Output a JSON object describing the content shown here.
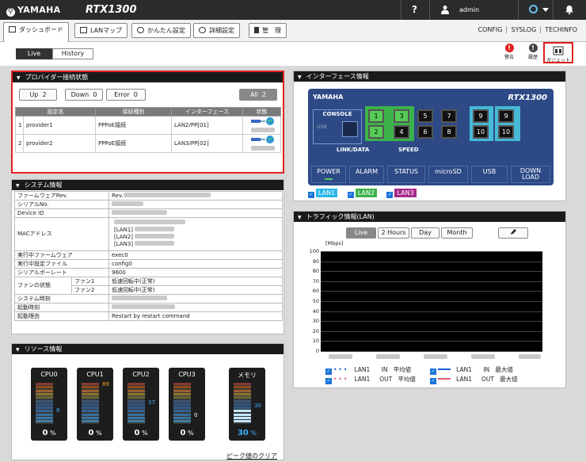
{
  "topbar": {
    "brand": "YAMAHA",
    "model": "RTX1300",
    "help": "?",
    "user": "admin"
  },
  "tabs": [
    {
      "label": "ダッシュボード"
    },
    {
      "label": "LANマップ"
    },
    {
      "label": "かんたん設定"
    },
    {
      "label": "詳細設定"
    },
    {
      "label": "管　理"
    }
  ],
  "right_links": [
    "CONFIG",
    "SYSLOG",
    "TECHINFO"
  ],
  "subtabs": {
    "live": "Live",
    "history": "History"
  },
  "topicons": {
    "warning": "警告",
    "history": "履歴",
    "gadget": "ガジェット"
  },
  "provider": {
    "title": "プロバイダー接続状態",
    "btn_up": "Up",
    "up_count": "2",
    "btn_down": "Down",
    "down_count": "0",
    "btn_error": "Error",
    "error_count": "0",
    "btn_all": "All",
    "all_count": "2",
    "headers": [
      "設定名",
      "接続種別",
      "インターフェース",
      "状態"
    ],
    "rows": [
      {
        "no": "1",
        "name": "provider1",
        "type": "PPPoE接続",
        "iface": "LAN2/PP[01]"
      },
      {
        "no": "2",
        "name": "provider2",
        "type": "PPPoE接続",
        "iface": "LAN3/PP[02]"
      }
    ]
  },
  "system": {
    "title": "システム情報",
    "fw_rev_label": "ファームウェアRev.",
    "fw_rev_value": "Rev.",
    "serial_label": "シリアルNo.",
    "devid_label": "Device ID",
    "mac_label": "MACアドレス",
    "mac1": "[LAN1]",
    "mac2": "[LAN2]",
    "mac3": "[LAN3]",
    "exec_fw_label": "実行中ファームウェア",
    "exec_fw_value": "exec0",
    "exec_cfg_label": "実行中設定ファイル",
    "exec_cfg_value": "config0",
    "baud_label": "シリアルボーレート",
    "baud_value": "9600",
    "fan_label": "ファンの状態",
    "fan1_label": "ファン1",
    "fan1_value": "低速回転中(正常)",
    "fan2_label": "ファン2",
    "fan2_value": "低速回転中(正常)",
    "time_label": "システム時刻",
    "boot_time_label": "起動時刻",
    "boot_reason_label": "起動理由",
    "boot_reason_value": "Restart by restart command"
  },
  "resource": {
    "title": "リソース情報",
    "meters": [
      {
        "name": "CPU0",
        "percent": "0",
        "peak": "8",
        "unit": "%"
      },
      {
        "name": "CPU1",
        "percent": "0",
        "peak": "89",
        "unit": "%"
      },
      {
        "name": "CPU2",
        "percent": "0",
        "peak": "37",
        "unit": "%"
      },
      {
        "name": "CPU3",
        "percent": "0",
        "peak": "0",
        "unit": "%"
      },
      {
        "name": "メモリ",
        "percent": "30",
        "peak": "30",
        "unit": "%"
      }
    ],
    "peak_clear": "ピーク値のクリア"
  },
  "interface": {
    "title": "インターフェース情報",
    "brand": "YAMAHA",
    "model": "RTX1300",
    "console": "CONSOLE",
    "usb": "USB",
    "linkdata": "LINK/DATA",
    "speed": "SPEED",
    "ports": [
      "1",
      "2",
      "3",
      "4",
      "5",
      "6",
      "7",
      "8",
      "9",
      "10",
      "9",
      "10"
    ],
    "indicators": [
      "POWER",
      "ALARM",
      "STATUS",
      "microSD",
      "USB",
      "DOWN\nLOAD"
    ],
    "lan_tags": [
      "LAN1",
      "LAN2",
      "LAN3"
    ],
    "lan_colors": [
      "#29b6e8",
      "#3cb34a",
      "#a52a8a"
    ]
  },
  "traffic": {
    "title": "トラフィック情報(LAN)",
    "btn_live": "Live",
    "btn_2h": "2 Hours",
    "btn_day": "Day",
    "btn_month": "Month",
    "unit": "[Mbps]",
    "yticks": [
      "100",
      "90",
      "80",
      "70",
      "60",
      "50",
      "40",
      "30",
      "20",
      "10",
      "0"
    ],
    "legend": [
      {
        "lan": "LAN1",
        "dir": "IN",
        "kind": "平均値"
      },
      {
        "lan": "LAN1",
        "dir": "IN",
        "kind": "最大値"
      },
      {
        "lan": "LAN1",
        "dir": "OUT",
        "kind": "平均値"
      },
      {
        "lan": "LAN1",
        "dir": "OUT",
        "kind": "最大値"
      }
    ]
  }
}
